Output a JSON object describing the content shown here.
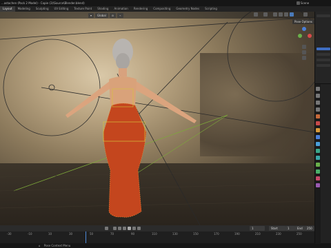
{
  "window": {
    "title": "...astachen (Pack 2 Model) - Copie (3)\\Source\\Blender.blend)",
    "scene_name": "Scene"
  },
  "workspace_tabs": [
    {
      "label": "Layout",
      "active": true
    },
    {
      "label": "Modeling"
    },
    {
      "label": "Sculpting"
    },
    {
      "label": "UV Editing"
    },
    {
      "label": "Texture Paint"
    },
    {
      "label": "Shading"
    },
    {
      "label": "Animation"
    },
    {
      "label": "Rendering"
    },
    {
      "label": "Compositing"
    },
    {
      "label": "Geometry Nodes"
    },
    {
      "label": "Scripting"
    }
  ],
  "viewport": {
    "orientation": "Global",
    "pose_options": "Pose Options"
  },
  "timeline": {
    "current_frame": "1",
    "start_label": "Start",
    "start_value": "1",
    "end_label": "End",
    "end_value": "250",
    "ticks": [
      "-30",
      "-10",
      "10",
      "30",
      "50",
      "70",
      "90",
      "110",
      "130",
      "150",
      "170",
      "190",
      "210",
      "230",
      "250"
    ]
  },
  "statusbar": {
    "text": "Pose Context Menu"
  },
  "colors": {
    "accent": "#4d8ad9",
    "selection": "#3f6ec2"
  }
}
